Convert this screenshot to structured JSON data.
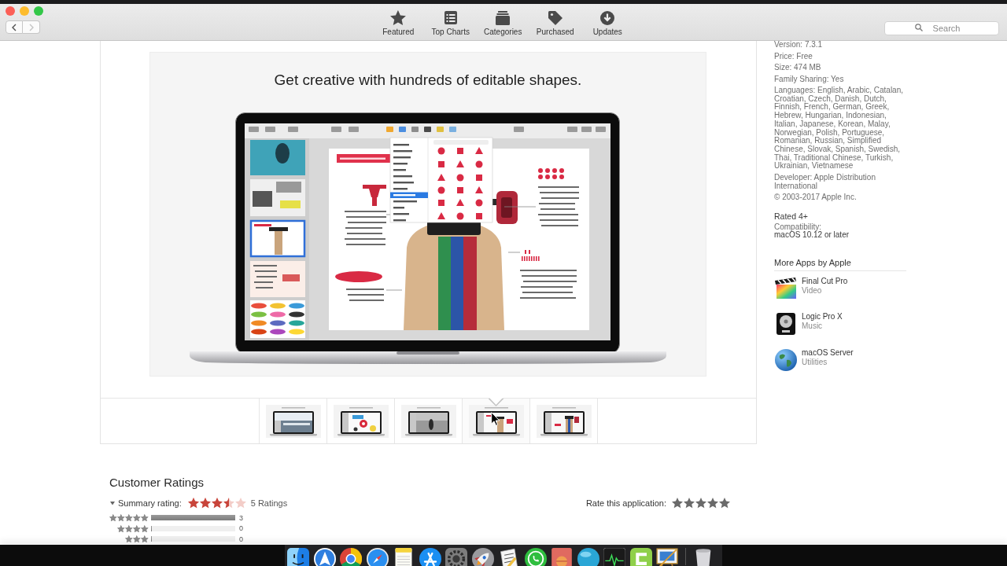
{
  "window": {
    "controls": [
      {
        "color": "#fc5f57"
      },
      {
        "color": "#fdbc2e"
      },
      {
        "color": "#33c748"
      }
    ]
  },
  "toolbar": {
    "nav_buttons": [
      {
        "kind": "back",
        "disabled": false
      },
      {
        "kind": "forward",
        "disabled": true
      }
    ],
    "tabs": [
      {
        "kind": "featured",
        "label": "Featured",
        "selected": false
      },
      {
        "kind": "top_charts",
        "label": "Top Charts",
        "selected": false
      },
      {
        "kind": "categories",
        "label": "Categories",
        "selected": false
      },
      {
        "kind": "purchased",
        "label": "Purchased",
        "selected": false
      },
      {
        "kind": "updates",
        "label": "Updates",
        "selected": false
      }
    ],
    "search": {
      "placeholder": "Search"
    }
  },
  "gallery": {
    "caption": "Get creative with hundreds of editable shapes.",
    "screenshots": [
      {
        "selected": false
      },
      {
        "selected": false
      },
      {
        "selected": false
      },
      {
        "selected": true
      },
      {
        "selected": false
      }
    ]
  },
  "sidebar": {
    "details": [
      "Version: 7.3.1",
      "Price: Free",
      "Size: 474 MB",
      "Family Sharing: Yes",
      "Languages: English, Arabic, Catalan, Croatian, Czech, Danish, Dutch, Finnish, French, German, Greek, Hebrew, Hungarian, Indonesian, Italian, Japanese, Korean, Malay, Norwegian, Polish, Portuguese, Romanian, Russian, Simplified Chinese, Slovak, Spanish, Swedish, Thai, Traditional Chinese, Turkish, Ukrainian, Vietnamese",
      "Developer: Apple Distribution International",
      "© 2003-2017 Apple Inc."
    ],
    "age_rating": "Rated 4+",
    "compatibility": {
      "label": "Compatibility:",
      "value": "macOS 10.12 or later"
    },
    "more_apps": {
      "title": "More Apps by Apple",
      "apps": [
        {
          "name": "Final Cut Pro",
          "category": "Video"
        },
        {
          "name": "Logic Pro X",
          "category": "Music"
        },
        {
          "name": "macOS Server",
          "category": "Utilities"
        }
      ]
    }
  },
  "ratings": {
    "title": "Customer Ratings",
    "summary": {
      "label": "Summary rating:",
      "expanded": true,
      "stars": 3.5,
      "count": "5 Ratings"
    },
    "histogram": [
      {
        "stars": 5,
        "level": 1,
        "count": "3"
      },
      {
        "stars": 4,
        "level": 0,
        "count": "0"
      },
      {
        "stars": 3,
        "level": 0,
        "count": "0"
      }
    ],
    "rate": {
      "label": "Rate this application:"
    }
  }
}
